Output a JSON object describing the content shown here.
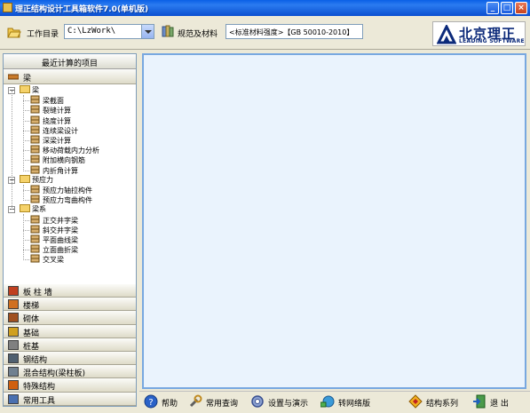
{
  "window": {
    "title": "理正结构设计工具箱软件7.0(单机版)",
    "min": "_",
    "max": "□",
    "close": "×"
  },
  "toolbar": {
    "workdir_label": "工作目录",
    "workdir_value": "C:\\LzWork\\",
    "std_label": "规范及材料",
    "std_value": "<标准材料强度>【GB 50010-2010】"
  },
  "logo": {
    "cn": "北京理正",
    "en": "LEADING SOFTWARE"
  },
  "sidebar": {
    "recent": "最近计算的项目",
    "active_group": "梁",
    "tree": [
      {
        "label": "梁",
        "type": "folder"
      },
      {
        "label": "梁截面",
        "type": "leaf"
      },
      {
        "label": "裂缝计算",
        "type": "leaf"
      },
      {
        "label": "挠度计算",
        "type": "leaf"
      },
      {
        "label": "连续梁设计",
        "type": "leaf"
      },
      {
        "label": "深梁计算",
        "type": "leaf"
      },
      {
        "label": "移动荷载内力分析",
        "type": "leaf"
      },
      {
        "label": "附加横向钢筋",
        "type": "leaf"
      },
      {
        "label": "内折角计算",
        "type": "leaf"
      },
      {
        "label": "预应力",
        "type": "folder"
      },
      {
        "label": "预应力轴拉构件",
        "type": "leaf"
      },
      {
        "label": "预应力弯曲构件",
        "type": "leaf"
      },
      {
        "label": "梁系",
        "type": "folder"
      },
      {
        "label": "正交井字梁",
        "type": "leaf"
      },
      {
        "label": "斜交井字梁",
        "type": "leaf"
      },
      {
        "label": "平面曲线梁",
        "type": "leaf"
      },
      {
        "label": "立面曲折梁",
        "type": "leaf"
      },
      {
        "label": "交叉梁",
        "type": "leaf"
      }
    ],
    "groups": [
      {
        "label": "板 柱 墙"
      },
      {
        "label": "楼梯"
      },
      {
        "label": "砌体"
      },
      {
        "label": "基础"
      },
      {
        "label": "桩基"
      },
      {
        "label": "钢结构"
      },
      {
        "label": "混合结构(梁柱板)"
      },
      {
        "label": "特殊结构"
      },
      {
        "label": "常用工具"
      }
    ]
  },
  "bottombar": {
    "help": "帮助",
    "query": "常用查询",
    "settings": "设置与演示",
    "network": "转网络版",
    "series": "结构系列",
    "exit": "退 出"
  },
  "colors": {
    "titlebar": "#0a5fe6",
    "content_bg": "#eaf3fd",
    "content_border": "#78a8e0",
    "chrome": "#ece9d8"
  }
}
